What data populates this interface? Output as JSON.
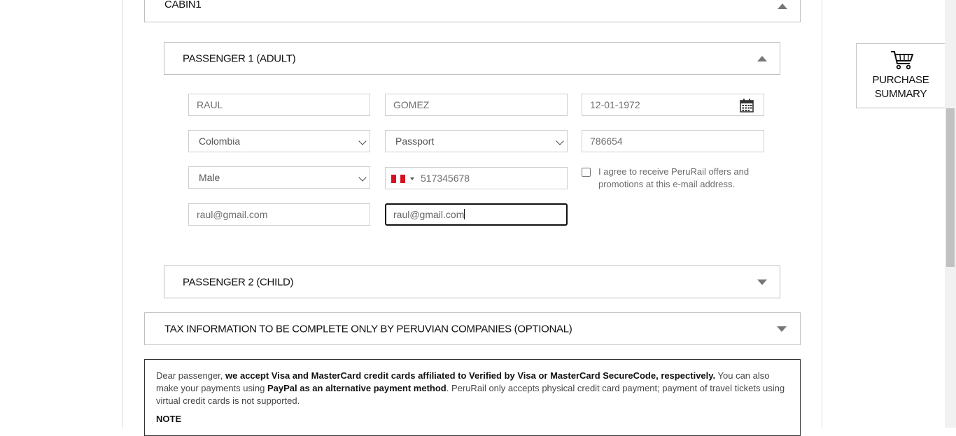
{
  "cabin": {
    "title": "CABIN1"
  },
  "passenger1": {
    "title": "PASSENGER 1 (ADULT)",
    "first_name": "RAUL",
    "last_name": "GOMEZ",
    "birth_date": "12-01-1972",
    "country": "Colombia",
    "document_type": "Passport",
    "document_number": "786654",
    "gender": "Male",
    "phone_country_flag": "Peru",
    "phone": "517345678",
    "consent_text": "I agree to receive PeruRail offers and promotions at this e-mail address.",
    "email": "raul@gmail.com",
    "email_confirm": "raul@gmail.com"
  },
  "passenger2": {
    "title": "PASSENGER 2 (CHILD)"
  },
  "tax": {
    "title": "TAX INFORMATION TO BE COMPLETE ONLY BY PERUVIAN COMPANIES (OPTIONAL)"
  },
  "notice": {
    "p1": "Dear passenger, ",
    "p2": "we accept Visa and MasterCard credit cards affiliated to Verified by Visa or MasterCard SecureCode, respectively.",
    "p3": " You can also make your payments using ",
    "p4": "PayPal as an alternative payment method",
    "p5": ". PeruRail only accepts physical credit card payment; payment of travel tickets using virtual credit cards is not supported.",
    "note_title": "NOTE"
  },
  "summary": {
    "line1": "PURCHASE",
    "line2": "SUMMARY"
  },
  "colors": {
    "flag_red": "#d91023",
    "flag_white": "#ffffff",
    "border": "#bfbfbf",
    "focus": "#111111"
  },
  "icons": {
    "calendar": "calendar-icon",
    "cart": "cart-icon"
  }
}
